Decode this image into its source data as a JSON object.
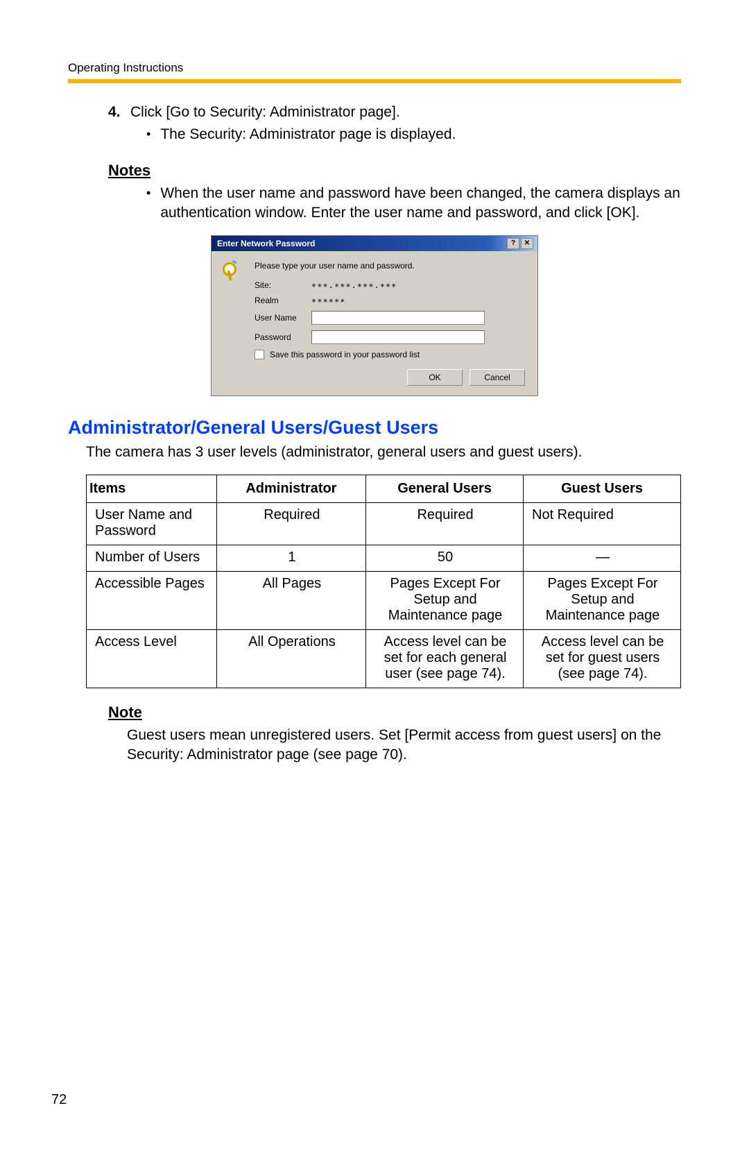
{
  "header": "Operating Instructions",
  "step": {
    "num": "4.",
    "text": "Click [Go to Security: Administrator page].",
    "sub": "The Security: Administrator page is displayed."
  },
  "notes": {
    "heading": "Notes",
    "text": "When the user name and password have been changed, the camera displays an authentication window. Enter the user name and password, and click [OK]."
  },
  "dialog": {
    "title": "Enter Network Password",
    "help": "?",
    "close": "✕",
    "prompt": "Please type your user name and password.",
    "site_label": "Site:",
    "site_value": "∗∗∗.∗∗∗.∗∗∗.∗∗∗",
    "realm_label": "Realm",
    "realm_value": "∗∗∗∗∗∗",
    "user_label": "User Name",
    "pass_label": "Password",
    "save_label": "Save this password in your password list",
    "ok": "OK",
    "cancel": "Cancel"
  },
  "section": {
    "heading": "Administrator/General Users/Guest Users",
    "intro": "The camera has 3 user levels (administrator, general users and guest users)."
  },
  "table": {
    "h_items": "Items",
    "h_admin": "Administrator",
    "h_gen": "General Users",
    "h_guest": "Guest Users",
    "rows": [
      {
        "items": "User Name and Password",
        "admin": "Required",
        "gen": "Required",
        "guest": "Not Required"
      },
      {
        "items": "Number of Users",
        "admin": "1",
        "gen": "50",
        "guest": "—"
      },
      {
        "items": "Accessible Pages",
        "admin": "All Pages",
        "gen": "Pages Except For Setup and Maintenance page",
        "guest": "Pages Except For Setup and Maintenance page"
      },
      {
        "items": "Access Level",
        "admin": "All Operations",
        "gen": "Access level can be set for each general user (see page 74).",
        "guest": "Access level can be set for guest users (see page 74)."
      }
    ]
  },
  "note2": {
    "heading": "Note",
    "text": "Guest users mean unregistered users. Set [Permit access from guest users] on the Security: Administrator page (see page 70)."
  },
  "page_number": "72"
}
